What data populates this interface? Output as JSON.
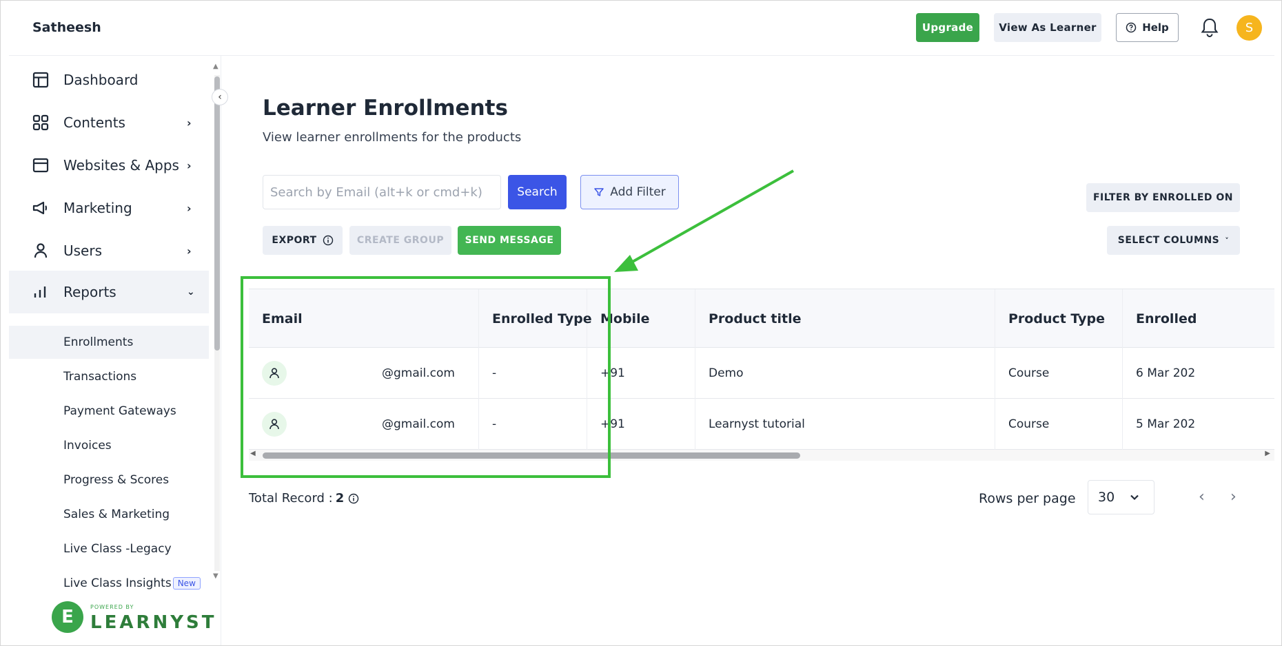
{
  "header": {
    "brand": "Satheesh",
    "upgrade_label": "Upgrade",
    "view_as_learner_label": "View As Learner",
    "help_label": "Help",
    "avatar_initial": "S"
  },
  "sidebar": {
    "items": [
      {
        "label": "Dashboard",
        "icon": "layout-icon"
      },
      {
        "label": "Contents",
        "icon": "grid-icon"
      },
      {
        "label": "Websites & Apps",
        "icon": "browser-icon"
      },
      {
        "label": "Marketing",
        "icon": "megaphone-icon"
      },
      {
        "label": "Users",
        "icon": "user-icon"
      },
      {
        "label": "Reports",
        "icon": "bar-chart-icon"
      }
    ],
    "sub_items": [
      "Enrollments",
      "Transactions",
      "Payment Gateways",
      "Invoices",
      "Progress & Scores",
      "Sales & Marketing",
      "Live Class -Legacy",
      "Live Class Insights"
    ],
    "new_badge": "New",
    "powered_by": "POWERED BY",
    "logo_word": "LEARNYST",
    "logo_letter": "E"
  },
  "main": {
    "title": "Learner Enrollments",
    "subtitle": "View learner enrollments for the products",
    "search_placeholder": "Search by Email (alt+k or cmd+k)",
    "search_button": "Search",
    "add_filter": "Add Filter",
    "export": "EXPORT",
    "create_group": "CREATE GROUP",
    "send_message": "SEND MESSAGE",
    "filter_enrolled": "FILTER BY ENROLLED ON",
    "select_columns": "SELECT COLUMNS"
  },
  "table": {
    "columns": [
      "Email",
      "Enrolled Type",
      "Mobile",
      "Product title",
      "Product Type",
      "Enrolled"
    ],
    "rows": [
      {
        "email": "@gmail.com",
        "enrolled_type": "-",
        "mobile": "+91",
        "product_title": "Demo",
        "product_type": "Course",
        "enrolled": "6 Mar 202"
      },
      {
        "email": "@gmail.com",
        "enrolled_type": "-",
        "mobile": "+91",
        "product_title": "Learnyst tutorial",
        "product_type": "Course",
        "enrolled": "5 Mar 202"
      }
    ]
  },
  "footer": {
    "total_label": "Total Record :",
    "total_value": "2",
    "rows_per_page_label": "Rows per page",
    "rows_per_page_value": "30"
  },
  "colors": {
    "accent_blue": "#3b55e6",
    "green": "#3aa54b",
    "annotation": "#3cbf3c"
  }
}
